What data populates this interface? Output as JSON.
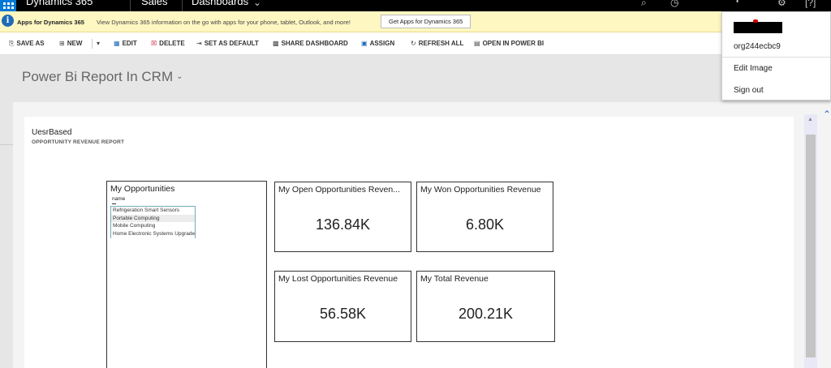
{
  "topnav": {
    "app_name": "Dynamics 365",
    "module": "Sales",
    "area": "Dashboards"
  },
  "notification": {
    "title": "Apps for Dynamics 365",
    "message": "View Dynamics 365 information on the go with apps for your phone, tablet, Outlook, and more!",
    "button": "Get Apps for Dynamics 365"
  },
  "toolbar": {
    "save_as": "SAVE AS",
    "new": "NEW",
    "edit": "EDIT",
    "delete": "DELETE",
    "set_default": "SET AS DEFAULT",
    "share": "SHARE DASHBOARD",
    "assign": "ASSIGN",
    "refresh": "REFRESH ALL",
    "open_powerbi": "OPEN IN POWER BI"
  },
  "dashboard": {
    "title": "Power Bi Report In CRM"
  },
  "report": {
    "title": "UesrBased",
    "subtitle": "OPPORTUNITY REVENUE REPORT",
    "slicer": {
      "title": "My Opportunities",
      "column": "name",
      "items": [
        "Refrigeration Smart Sensors",
        "Portable Computing",
        "Mobile Computing",
        "Home Electronic Systems Upgrade"
      ]
    },
    "cards": [
      {
        "title": "My Open Opportunities Reven...",
        "value": "136.84K"
      },
      {
        "title": "My Won Opportunities Revenue",
        "value": "6.80K"
      },
      {
        "title": "My Lost Opportunities Revenue",
        "value": "56.58K"
      },
      {
        "title": "My Total Revenue",
        "value": "200.21K"
      }
    ]
  },
  "user_menu": {
    "org": "org244ecbc9",
    "edit_image": "Edit Image",
    "sign_out": "Sign out"
  },
  "colors": {
    "nav_bg": "#000000",
    "waffle_blue": "#0078d4",
    "notification_bg": "#fff7c2"
  }
}
